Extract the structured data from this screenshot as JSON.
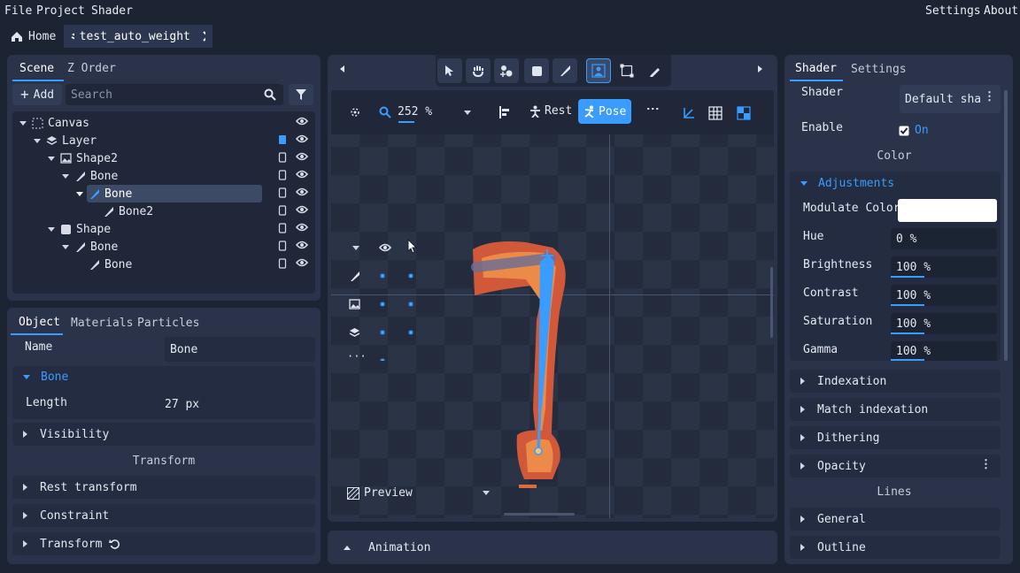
{
  "menu": {
    "file": "File",
    "project": "Project",
    "shader": "Shader",
    "settings": "Settings",
    "about": "About"
  },
  "tabs": {
    "home": "Home",
    "file": "test_auto_weight"
  },
  "scene_panel": {
    "tab_scene": "Scene",
    "tab_zorder": "Z Order",
    "add_label": "Add",
    "search_placeholder": "Search",
    "tree": [
      {
        "label": "Canvas"
      },
      {
        "label": "Layer"
      },
      {
        "label": "Shape2"
      },
      {
        "label": "Bone"
      },
      {
        "label": "Bone"
      },
      {
        "label": "Bone2"
      },
      {
        "label": "Shape"
      },
      {
        "label": "Bone"
      },
      {
        "label": "Bone"
      }
    ]
  },
  "object_panel": {
    "tab_object": "Object",
    "tab_materials": "Materials",
    "tab_particles": "Particles",
    "name_label": "Name",
    "name_value": "Bone",
    "section_bone": "Bone",
    "length_label": "Length",
    "length_value": "27 px",
    "visibility": "Visibility",
    "transform_header": "Transform",
    "rest_transform": "Rest transform",
    "constraint": "Constraint",
    "transform": "Transform"
  },
  "viewport": {
    "zoom": "252 %",
    "rest": "Rest",
    "pose": "Pose",
    "preview": "Preview",
    "animation": "Animation"
  },
  "shader_panel": {
    "tab_shader": "Shader",
    "tab_settings": "Settings",
    "shader_label": "Shader",
    "shader_value": "Default sha",
    "enable_label": "Enable",
    "enable_value": "On",
    "color_header": "Color",
    "adjustments": "Adjustments",
    "modulate_label": "Modulate Color",
    "modulate_color": "#ffffff",
    "hue_label": "Hue",
    "hue_value": "0 %",
    "brightness_label": "Brightness",
    "brightness_value": "100 %",
    "contrast_label": "Contrast",
    "contrast_value": "100 %",
    "saturation_label": "Saturation",
    "saturation_value": "100 %",
    "gamma_label": "Gamma",
    "gamma_value": "100 %",
    "indexation": "Indexation",
    "match_indexation": "Match indexation",
    "dithering": "Dithering",
    "opacity": "Opacity",
    "lines_header": "Lines",
    "general": "General",
    "outline": "Outline"
  },
  "colors": {
    "accent": "#3b9cff",
    "panel": "#2a334a",
    "bg": "#1c2333"
  }
}
